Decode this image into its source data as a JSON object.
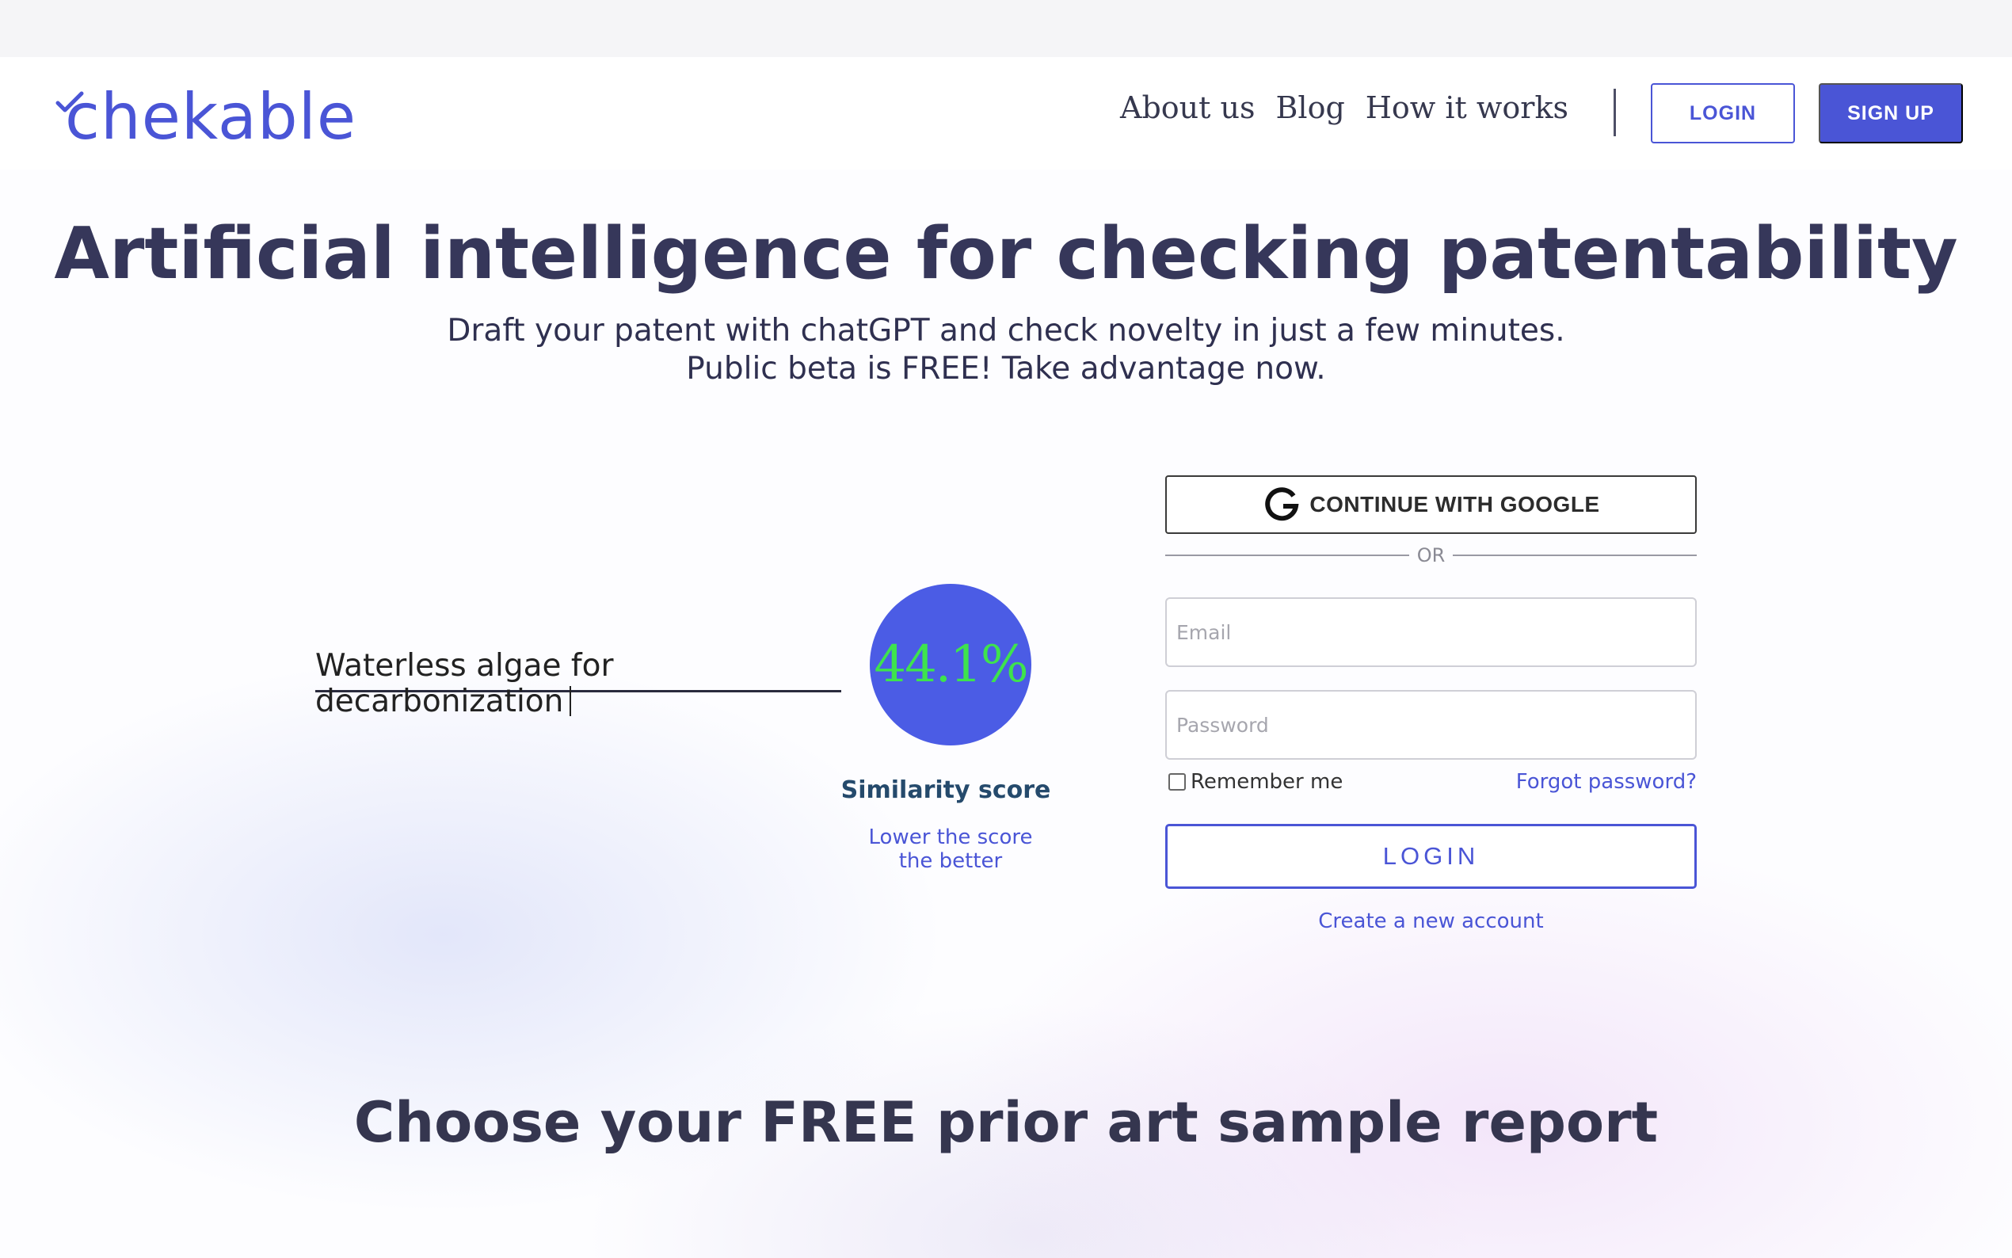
{
  "brand": {
    "logo_text": "chekable",
    "accent": "#4a55d6"
  },
  "nav": {
    "items": [
      "About us",
      "Blog",
      "How it works"
    ],
    "login_label": "LOGIN",
    "signup_label": "SIGN UP"
  },
  "hero": {
    "title": "Artificial intelligence for checking patentability",
    "subtitle_line1": "Draft your patent with chatGPT and check novelty in just a few minutes.",
    "subtitle_line2": "Public beta is FREE! Take advantage now."
  },
  "demo": {
    "input_text": "Waterless algae for decarbonization",
    "score": "44.1%",
    "score_label": "Similarity score",
    "score_hint_line1": "Lower the score",
    "score_hint_line2": "the better"
  },
  "auth": {
    "google_label": "CONTINUE WITH GOOGLE",
    "google_icon": "google-g-icon",
    "or_label": "OR",
    "email_placeholder": "Email",
    "password_placeholder": "Password",
    "remember_label": "Remember me",
    "remember_checked": false,
    "forgot_label": "Forgot password?",
    "login_label": "LOGIN",
    "create_account_label": "Create a new account"
  },
  "sample_section": {
    "title": "Choose your FREE prior art sample report"
  }
}
